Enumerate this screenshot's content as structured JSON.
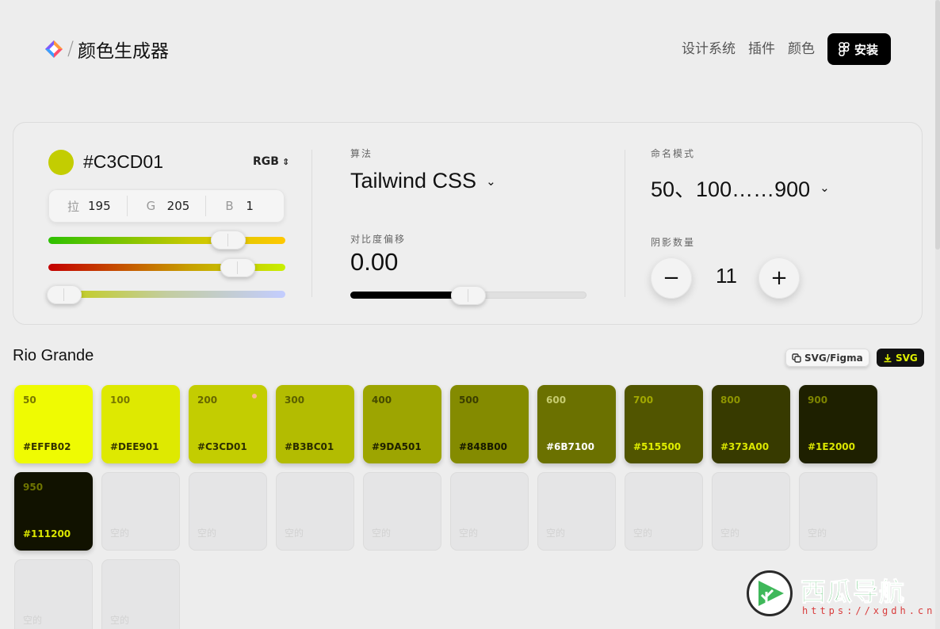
{
  "header": {
    "brand": "颜色生成器",
    "separator": "/",
    "nav": [
      "设计系统",
      "插件",
      "颜色"
    ],
    "install_label": "安装"
  },
  "picker": {
    "hex": "#C3CD01",
    "mode": "RGB",
    "channels": [
      {
        "key": "拉",
        "value": "195"
      },
      {
        "key": "G",
        "value": "205"
      },
      {
        "key": "B",
        "value": "1"
      }
    ],
    "slider_levels": {
      "r": 0.76,
      "g": 0.8,
      "b": 0.004
    }
  },
  "algorithm": {
    "label": "算法",
    "value": "Tailwind CSS"
  },
  "contrast": {
    "label": "对比度偏移",
    "value": "0.00",
    "level": 0.5
  },
  "naming": {
    "label": "命名模式",
    "value": "50、100……900"
  },
  "shadows": {
    "label": "阴影数量",
    "count": "11",
    "minus": "−",
    "plus": "+"
  },
  "palette": {
    "name": "Rio Grande",
    "figma_label": "SVG/Figma",
    "svg_label": "SVG",
    "swatches": [
      {
        "shade": "50",
        "hex": "#EFFB02",
        "bg": "#EFFB02",
        "fg": "#777700",
        "hexfg": "#333300"
      },
      {
        "shade": "100",
        "hex": "#DEE901",
        "bg": "#DEE901",
        "fg": "#777700",
        "hexfg": "#333300"
      },
      {
        "shade": "200",
        "hex": "#C3CD01",
        "bg": "#C3CD01",
        "fg": "#666600",
        "hexfg": "#2e3000",
        "current": true
      },
      {
        "shade": "300",
        "hex": "#B3BC01",
        "bg": "#B3BC01",
        "fg": "#5a5f00",
        "hexfg": "#2a2c00"
      },
      {
        "shade": "400",
        "hex": "#9DA501",
        "bg": "#9DA501",
        "fg": "#454a00",
        "hexfg": "#1e2000"
      },
      {
        "shade": "500",
        "hex": "#848B00",
        "bg": "#848B00",
        "fg": "#3a3d00",
        "hexfg": "#161800"
      },
      {
        "shade": "600",
        "hex": "#6B7100",
        "bg": "#6B7100",
        "fg": "#c7cc70",
        "hexfg": "#ffffff"
      },
      {
        "shade": "700",
        "hex": "#515500",
        "bg": "#515500",
        "fg": "#a2a800",
        "hexfg": "#e0ee00"
      },
      {
        "shade": "800",
        "hex": "#373A00",
        "bg": "#373A00",
        "fg": "#8e9500",
        "hexfg": "#dae600"
      },
      {
        "shade": "900",
        "hex": "#1E2000",
        "bg": "#1E2000",
        "fg": "#7d8400",
        "hexfg": "#dae600"
      },
      {
        "shade": "950",
        "hex": "#111200",
        "bg": "#111200",
        "fg": "#6f7500",
        "hexfg": "#dae600"
      }
    ],
    "empty_label": "空的",
    "empty_count": 11
  },
  "watermark": {
    "title": "西瓜导航",
    "url": "https://xgdh.cn"
  },
  "colors": {
    "accent": "#C3CD01",
    "install_bg": "#000000",
    "svg_btn_text": "#DFF000"
  }
}
